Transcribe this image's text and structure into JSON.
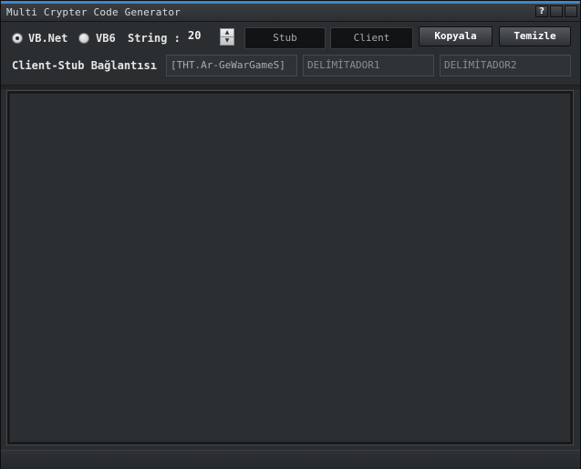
{
  "window": {
    "title": "Multi Crypter Code Generator",
    "help_glyph": "?",
    "accent_color": "#3f86c9"
  },
  "options": {
    "vbnet_label": "VB.Net",
    "vb6_label": "VB6",
    "selected": "VB.Net",
    "string_label": "String :",
    "string_value": "20"
  },
  "buttons": {
    "stub": "Stub",
    "client": "Client",
    "copy": "Kopyala",
    "clear": "Temizle"
  },
  "connection": {
    "label": "Client-Stub Bağlantısı",
    "key_value": "[THT.Ar-GeWarGameS]",
    "delimiter1_placeholder": "DELİMİTADOR1",
    "delimiter2_placeholder": "DELİMİTADOR2"
  },
  "output": {
    "text": ""
  }
}
